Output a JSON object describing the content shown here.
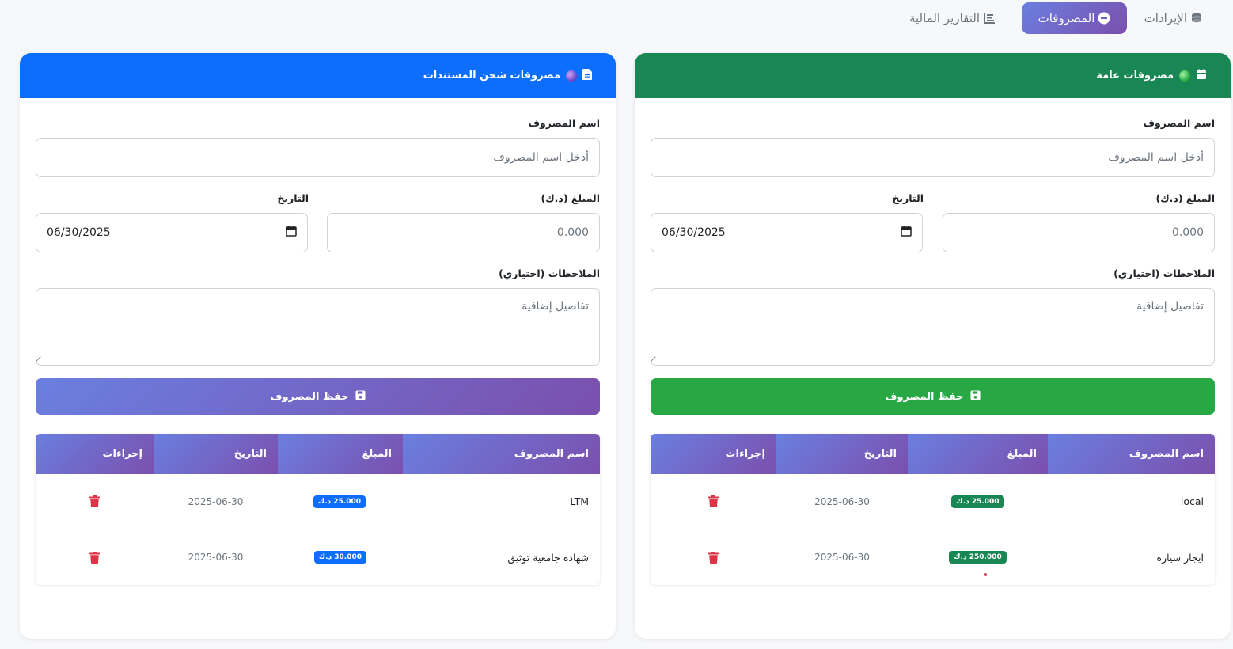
{
  "tabs": [
    {
      "label": "الإيرادات",
      "icon": "coins-icon",
      "active": false
    },
    {
      "label": "المصروفات",
      "icon": "minus-circle-icon",
      "active": true
    },
    {
      "label": "التقارير المالية",
      "icon": "chart-bar-icon",
      "active": false
    }
  ],
  "general": {
    "title": "مصروفات عامة",
    "title_icon": "calendar-icon",
    "name_label": "اسم المصروف",
    "name_placeholder": "أدخل اسم المصروف",
    "amount_label": "المبلغ (د.ك)",
    "amount_placeholder": "0.000",
    "date_label": "التاريخ",
    "date_value": "06/30/2025",
    "notes_label": "الملاحظات (اختياري)",
    "notes_placeholder": "تفاصيل إضافية",
    "save_label": "حفظ المصروف",
    "columns": [
      "اسم المصروف",
      "المبلغ",
      "التاريخ",
      "إجراءات"
    ],
    "rows": [
      {
        "name": "local",
        "amount": "25.000 د.ك",
        "date": "2025-06-30"
      },
      {
        "name": "ايجار سيارة",
        "amount": "250.000 د.ك",
        "date": "2025-06-30"
      }
    ],
    "accent": "#198754"
  },
  "docs": {
    "title": "مصروفات شحن المستندات",
    "title_icon": "file-icon",
    "name_label": "اسم المصروف",
    "name_placeholder": "أدخل اسم المصروف",
    "amount_label": "المبلغ (د.ك)",
    "amount_placeholder": "0.000",
    "date_label": "التاريخ",
    "date_value": "06/30/2025",
    "notes_label": "الملاحظات (اختياري)",
    "notes_placeholder": "تفاصيل إضافية",
    "save_label": "حفظ المصروف",
    "columns": [
      "اسم المصروف",
      "المبلغ",
      "التاريخ",
      "إجراءات"
    ],
    "rows": [
      {
        "name": "LTM",
        "amount": "25.000 د.ك",
        "date": "2025-06-30"
      },
      {
        "name": "شهادة جامعية توثيق",
        "amount": "30.000 د.ك",
        "date": "2025-06-30"
      }
    ],
    "accent": "#0d6efd"
  }
}
